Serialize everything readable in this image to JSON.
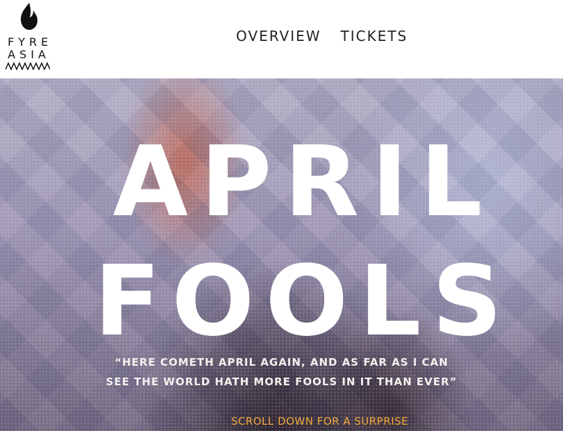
{
  "logo": {
    "line1": "FYRE",
    "line2": "ASIA",
    "flame_icon": "flame-icon",
    "zigzag_icon": "zigzag-icon"
  },
  "nav": {
    "items": [
      {
        "label": "OVERVIEW"
      },
      {
        "label": "TICKETS"
      }
    ]
  },
  "hero": {
    "headline_line1": "APRIL",
    "headline_line2": "FOOLS",
    "quote_line1": "“HERE COMETH APRIL AGAIN, AND AS FAR AS I CAN",
    "quote_line2": "SEE THE WORLD HATH MORE FOOLS IN IT THAN EVER”",
    "cta": "SCROLL DOWN FOR A SURPRISE"
  },
  "colors": {
    "cta": "#f2a93b",
    "headline": "#ffffff",
    "nav_text": "#222222"
  }
}
